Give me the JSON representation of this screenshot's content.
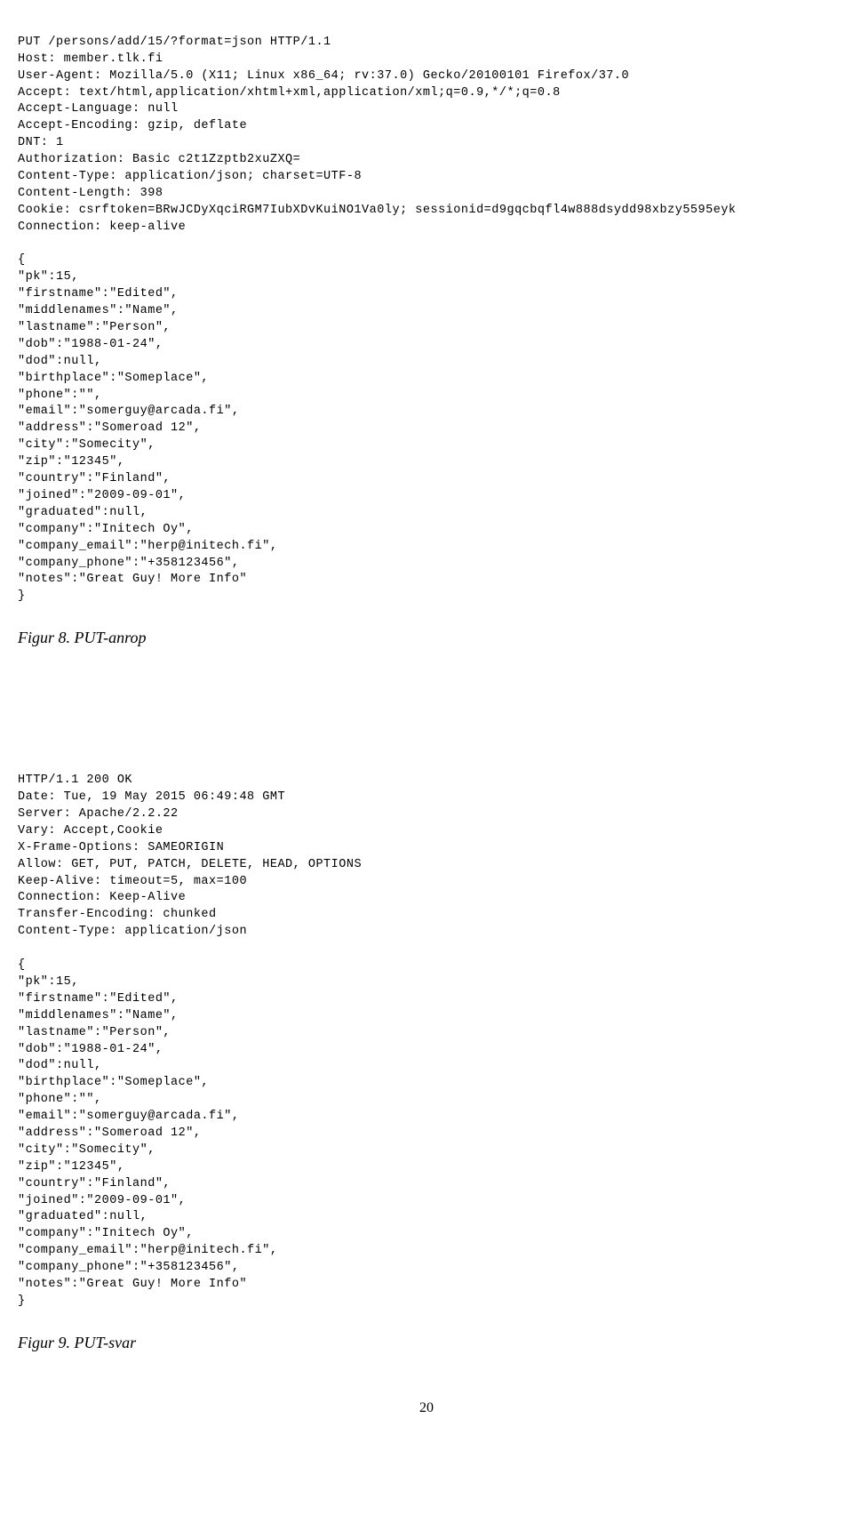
{
  "request": {
    "line1": "PUT /persons/add/15/?format=json HTTP/1.1",
    "line2": "Host: member.tlk.fi",
    "line3": "User-Agent: Mozilla/5.0 (X11; Linux x86_64; rv:37.0) Gecko/20100101 Firefox/37.0",
    "line4": "Accept: text/html,application/xhtml+xml,application/xml;q=0.9,*/*;q=0.8",
    "line5": "Accept-Language: null",
    "line6": "Accept-Encoding: gzip, deflate",
    "line7": "DNT: 1",
    "line8": "Authorization: Basic c2t1Zzptb2xuZXQ=",
    "line9": "Content-Type: application/json; charset=UTF-8",
    "line10": "Content-Length: 398",
    "line11": "Cookie: csrftoken=BRwJCDyXqciRGM7IubXDvKuiNO1Va0ly; sessionid=d9gqcbqfl4w888dsydd98xbzy5595eyk",
    "line12": "Connection: keep-alive"
  },
  "request_body": {
    "open": "{",
    "l1": "\"pk\":15,",
    "l2": "\"firstname\":\"Edited\",",
    "l3": "\"middlenames\":\"Name\",",
    "l4": "\"lastname\":\"Person\",",
    "l5": "\"dob\":\"1988-01-24\",",
    "l6": "\"dod\":null,",
    "l7": "\"birthplace\":\"Someplace\",",
    "l8": "\"phone\":\"\",",
    "l9": "\"email\":\"somerguy@arcada.fi\",",
    "l10": "\"address\":\"Someroad 12\",",
    "l11": "\"city\":\"Somecity\",",
    "l12": "\"zip\":\"12345\",",
    "l13": "\"country\":\"Finland\",",
    "l14": "\"joined\":\"2009-09-01\",",
    "l15": "\"graduated\":null,",
    "l16": "\"company\":\"Initech Oy\",",
    "l17": "\"company_email\":\"herp@initech.fi\",",
    "l18": "\"company_phone\":\"+358123456\",",
    "l19": "\"notes\":\"Great Guy! More Info\"",
    "close": "}"
  },
  "caption1": "Figur 8. PUT-anrop",
  "response": {
    "line1": "HTTP/1.1 200 OK",
    "line2": "Date: Tue, 19 May 2015 06:49:48 GMT",
    "line3": "Server: Apache/2.2.22",
    "line4": "Vary: Accept,Cookie",
    "line5": "X-Frame-Options: SAMEORIGIN",
    "line6": "Allow: GET, PUT, PATCH, DELETE, HEAD, OPTIONS",
    "line7": "Keep-Alive: timeout=5, max=100",
    "line8": "Connection: Keep-Alive",
    "line9": "Transfer-Encoding: chunked",
    "line10": "Content-Type: application/json"
  },
  "response_body": {
    "open": "{",
    "l1": "\"pk\":15,",
    "l2": "\"firstname\":\"Edited\",",
    "l3": "\"middlenames\":\"Name\",",
    "l4": "\"lastname\":\"Person\",",
    "l5": "\"dob\":\"1988-01-24\",",
    "l6": "\"dod\":null,",
    "l7": "\"birthplace\":\"Someplace\",",
    "l8": "\"phone\":\"\",",
    "l9": "\"email\":\"somerguy@arcada.fi\",",
    "l10": "\"address\":\"Someroad 12\",",
    "l11": "\"city\":\"Somecity\",",
    "l12": "\"zip\":\"12345\",",
    "l13": "\"country\":\"Finland\",",
    "l14": "\"joined\":\"2009-09-01\",",
    "l15": "\"graduated\":null,",
    "l16": "\"company\":\"Initech Oy\",",
    "l17": "\"company_email\":\"herp@initech.fi\",",
    "l18": "\"company_phone\":\"+358123456\",",
    "l19": "\"notes\":\"Great Guy! More Info\"",
    "close": "}"
  },
  "caption2": "Figur 9. PUT-svar",
  "page_number": "20"
}
